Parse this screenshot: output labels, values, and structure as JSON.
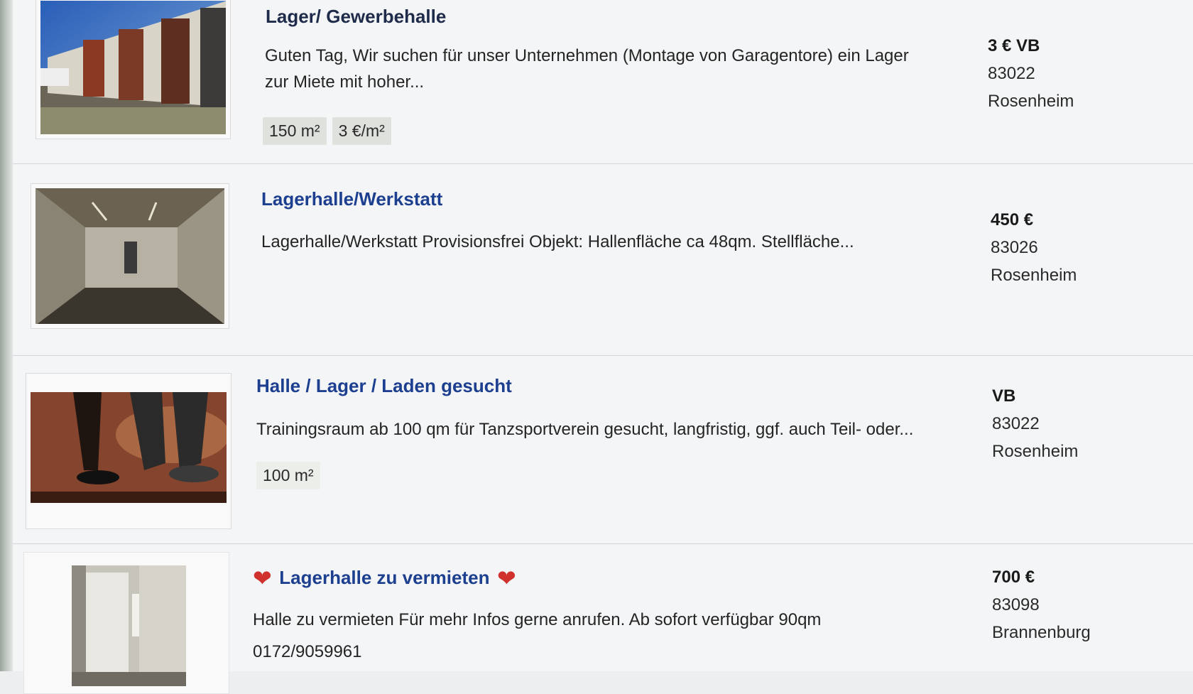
{
  "listings": [
    {
      "title": "Lager/ Gewerbehalle",
      "description": "Guten Tag, Wir suchen für unser Unternehmen (Montage von Garagentore) ein Lager zur Miete mit hoher...",
      "tags": [
        "150 m²",
        "3 €/m²"
      ],
      "price": "3 € VB",
      "zip": "83022",
      "city": "Rosenheim",
      "thumbnail": "garage-row-photo"
    },
    {
      "title": "Lagerhalle/Werkstatt",
      "description": "Lagerhalle/Werkstatt Provisionsfrei Objekt: Hallenfläche ca 48qm. Stellfläche...",
      "tags": [],
      "price": "450 €",
      "zip": "83026",
      "city": "Rosenheim",
      "thumbnail": "empty-hall-photo"
    },
    {
      "title": "Halle / Lager / Laden gesucht",
      "description": "Trainingsraum ab 100 qm für Tanzsportverein gesucht, langfristig, ggf. auch Teil- oder...",
      "tags": [
        "100 m²"
      ],
      "price": "VB",
      "zip": "83022",
      "city": "Rosenheim",
      "thumbnail": "dancing-feet-photo"
    },
    {
      "title": "Lagerhalle zu vermieten",
      "title_icon": "heart-icon",
      "description": "Halle zu vermieten Für mehr Infos gerne anrufen. Ab sofort verfügbar 90qm 0172/9059961",
      "tags": [],
      "price": "700 €",
      "zip": "83098",
      "city": "Brannenburg",
      "thumbnail": "white-room-photo"
    }
  ],
  "colors": {
    "title_link": "#1d3f8f",
    "heart": "#d0312d",
    "tag_bg": "#dfe2dc"
  }
}
